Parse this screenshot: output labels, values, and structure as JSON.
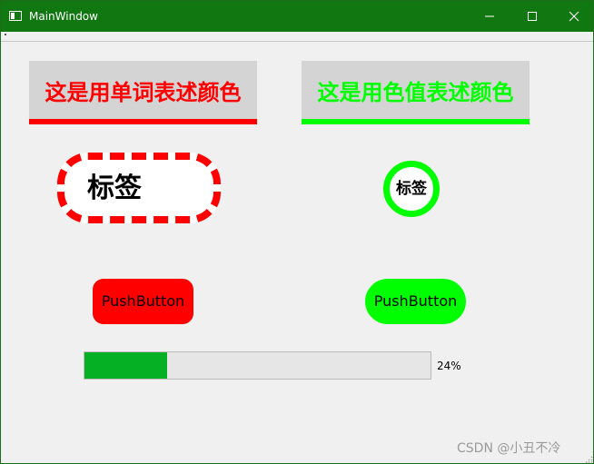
{
  "window": {
    "title": "MainWindow",
    "titlebar_color": "#117711",
    "icons": {
      "app": "app-window-icon",
      "minimize": "minimize-icon",
      "maximize": "maximize-icon",
      "close": "close-icon"
    }
  },
  "labels": {
    "word_color_text": "这是用单词表述颜色",
    "word_color_value": "#ff0000",
    "hex_color_text": "这是用色值表述颜色",
    "hex_color_value": "#00ff00",
    "pill_text": "标签",
    "pill_border_color": "#ff0000",
    "circle_text": "标签",
    "circle_border_color": "#00ff00"
  },
  "buttons": {
    "red_button_label": "PushButton",
    "red_button_color": "#ff0000",
    "green_button_label": "PushButton",
    "green_button_color": "#00ff00"
  },
  "progress": {
    "value": 24,
    "text": "24%",
    "fill_color": "#06b025"
  },
  "watermark": {
    "text": "CSDN @小丑不冷"
  }
}
